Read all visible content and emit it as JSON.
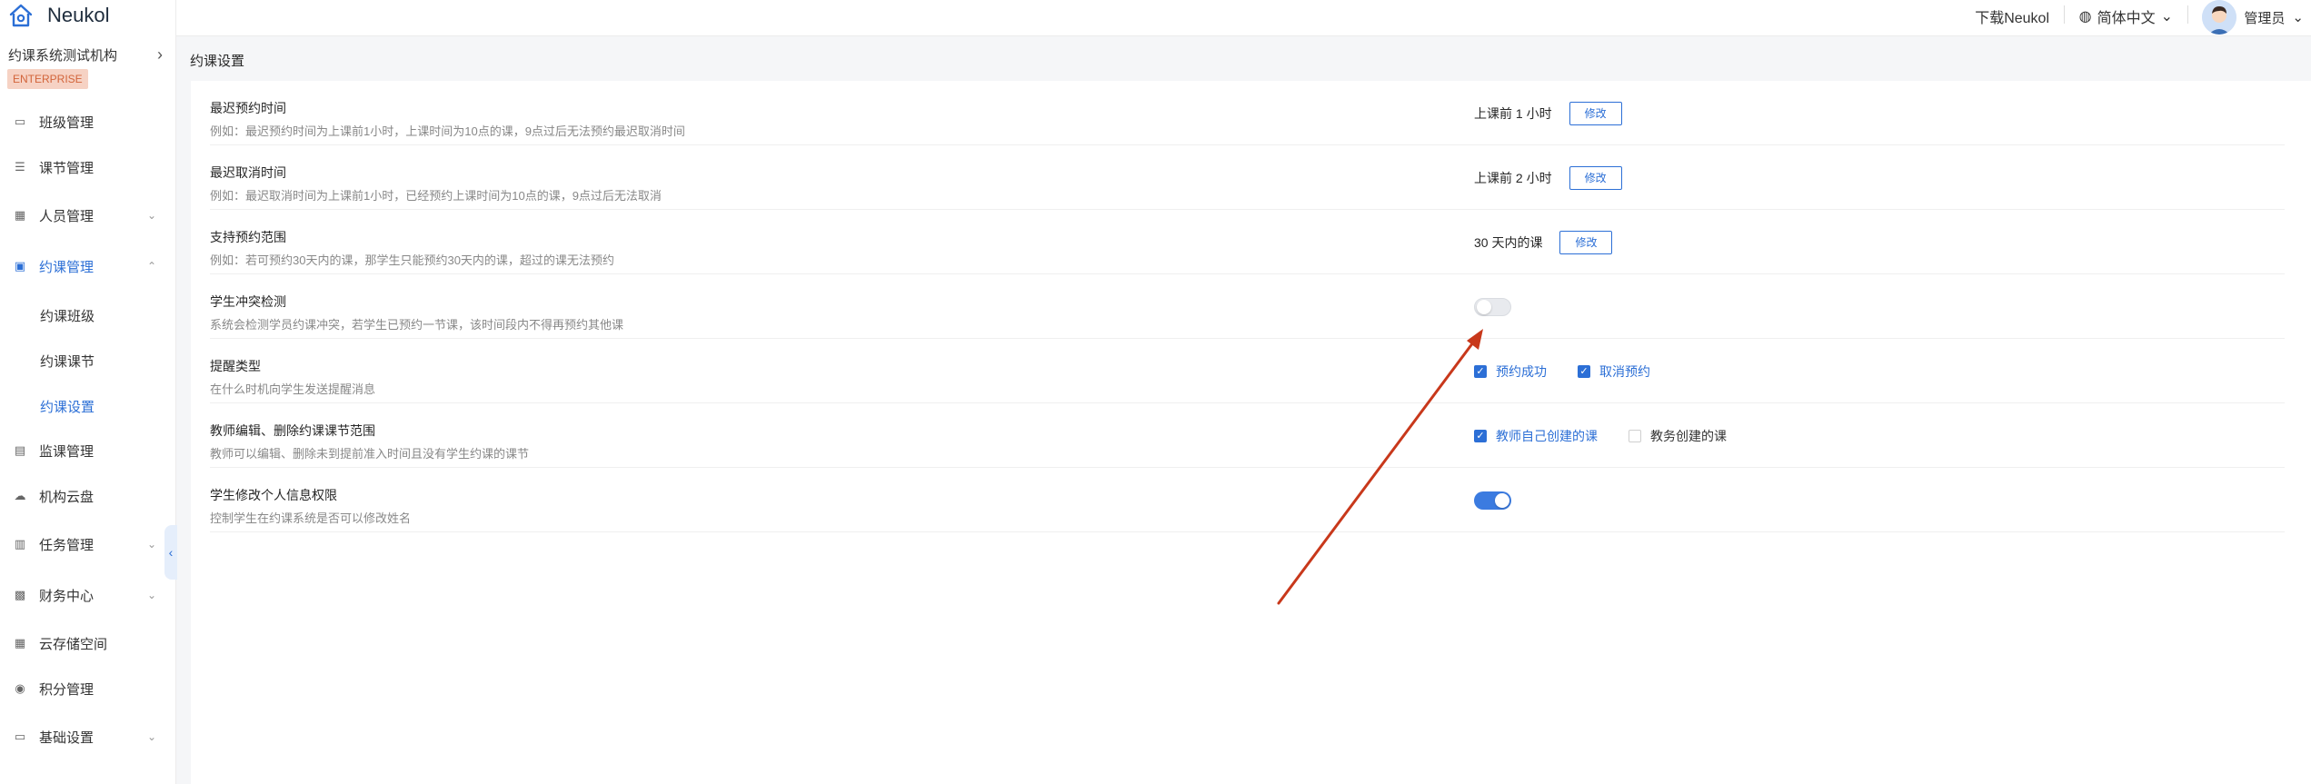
{
  "brand": {
    "name": "Neukol"
  },
  "org": {
    "name": "约课系统测试机构",
    "badge": "ENTERPRISE"
  },
  "sidebar": {
    "items": [
      {
        "label": "班级管理",
        "icon": "class-icon"
      },
      {
        "label": "课节管理",
        "icon": "lesson-icon"
      },
      {
        "label": "人员管理",
        "icon": "people-icon"
      },
      {
        "label": "约课管理",
        "icon": "booking-icon"
      },
      {
        "label": "监课管理",
        "icon": "monitor-icon"
      },
      {
        "label": "机构云盘",
        "icon": "cloud-icon"
      },
      {
        "label": "任务管理",
        "icon": "task-icon"
      },
      {
        "label": "财务中心",
        "icon": "finance-icon"
      },
      {
        "label": "云存储空间",
        "icon": "storage-icon"
      },
      {
        "label": "积分管理",
        "icon": "points-icon"
      },
      {
        "label": "基础设置",
        "icon": "settings-icon"
      }
    ],
    "sub_items": [
      {
        "label": "约课班级"
      },
      {
        "label": "约课课节"
      },
      {
        "label": "约课设置"
      }
    ],
    "accent_color": "#2c6fd6"
  },
  "header": {
    "download": "下载Neukol",
    "language": "简体中文",
    "user": "管理员"
  },
  "page": {
    "title": "约课设置"
  },
  "settings": {
    "latest_booking": {
      "label": "最迟预约时间",
      "desc": "例如：最迟预约时间为上课前1小时，上课时间为10点的课，9点过后无法预约最迟取消时间",
      "value": "上课前 1 小时",
      "button": "修改"
    },
    "latest_cancel": {
      "label": "最迟取消时间",
      "desc": "例如：最迟取消时间为上课前1小时，已经预约上课时间为10点的课，9点过后无法取消",
      "value": "上课前 2 小时",
      "button": "修改"
    },
    "booking_range": {
      "label": "支持预约范围",
      "desc": "例如：若可预约30天内的课，那学生只能预约30天内的课，超过的课无法预约",
      "value": "30 天内的课",
      "button": "修改"
    },
    "conflict_check": {
      "label": "学生冲突检测",
      "desc": "系统会检测学员约课冲突，若学生已预约一节课，该时间段内不得再预约其他课",
      "enabled": false
    },
    "reminder_type": {
      "label": "提醒类型",
      "desc": "在什么时机向学生发送提醒消息",
      "options": [
        {
          "label": "预约成功",
          "checked": true
        },
        {
          "label": "取消预约",
          "checked": true
        }
      ]
    },
    "teacher_edit_scope": {
      "label": "教师编辑、删除约课课节范围",
      "desc": "教师可以编辑、删除未到提前准入时间且没有学生约课的课节",
      "options": [
        {
          "label": "教师自己创建的课",
          "checked": true
        },
        {
          "label": "教务创建的课",
          "checked": false
        }
      ]
    },
    "student_profile_edit": {
      "label": "学生修改个人信息权限",
      "desc": "控制学生在约课系统是否可以修改姓名",
      "enabled": true
    }
  },
  "annotation": {
    "arrow_color": "#c8381b"
  }
}
